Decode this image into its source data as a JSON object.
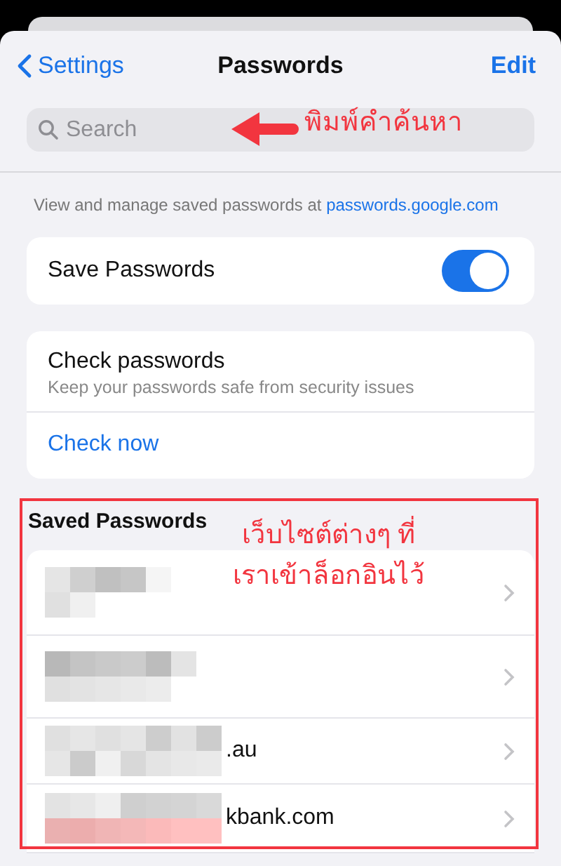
{
  "nav": {
    "back": "Settings",
    "title": "Passwords",
    "action": "Edit"
  },
  "search": {
    "placeholder": "Search"
  },
  "info": {
    "text": "View and manage saved passwords at ",
    "link": "passwords.google.com"
  },
  "save_passwords": {
    "label": "Save Passwords",
    "on": true
  },
  "check": {
    "title": "Check passwords",
    "subtitle": "Keep your passwords safe from security issues",
    "action": "Check now"
  },
  "saved": {
    "heading": "Saved Passwords",
    "rows": [
      {
        "kind": "redacted"
      },
      {
        "kind": "redacted"
      },
      {
        "kind": "partly-redacted",
        "site": ".au"
      },
      {
        "kind": "partly-redacted",
        "site": "kbank.com"
      }
    ]
  },
  "annotations": [
    {
      "kind": "arrow-label",
      "text": "พิมพ์คำค้นหา"
    },
    {
      "kind": "box-label",
      "text": "เว็บไซต์ต่างๆ ที่\nเราเข้าล็อกอินไว้"
    }
  ]
}
